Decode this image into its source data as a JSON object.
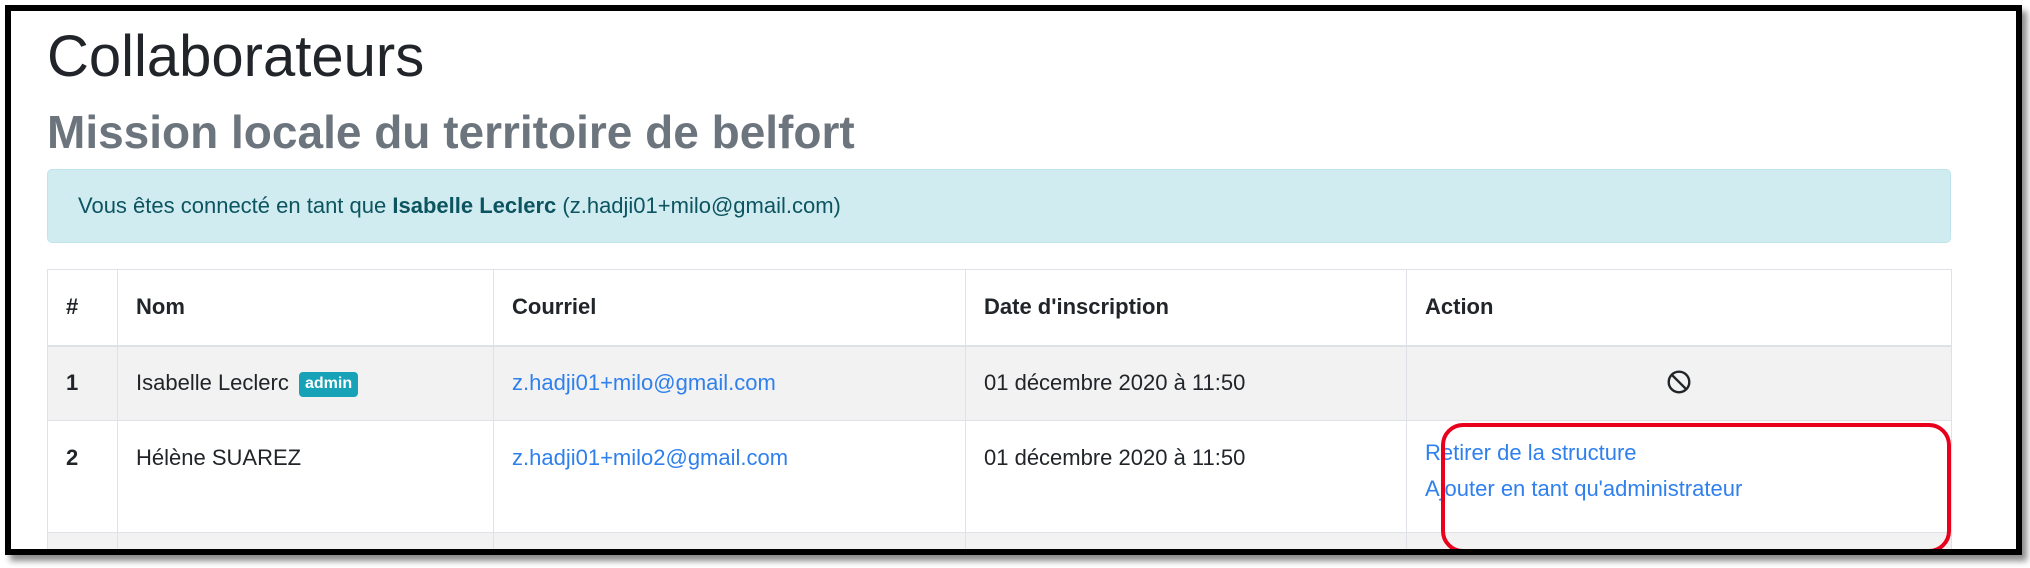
{
  "page": {
    "title": "Collaborateurs",
    "subtitle": "Mission locale du territoire de belfort"
  },
  "alert": {
    "prefix": "Vous êtes connecté en tant que",
    "user_name": "Isabelle Leclerc",
    "user_email": "(z.hadji01+milo@gmail.com)"
  },
  "table": {
    "headers": [
      "#",
      "Nom",
      "Courriel",
      "Date d'inscription",
      "Action"
    ],
    "rows": [
      {
        "num": "1",
        "name": "Isabelle Leclerc",
        "badge": "admin",
        "email": "z.hadji01+milo@gmail.com",
        "date": "01 décembre 2020 à 11:50",
        "action_icon": "ban-icon"
      },
      {
        "num": "2",
        "name": "Hélène SUAREZ",
        "email": "z.hadji01+milo2@gmail.com",
        "date": "01 décembre 2020 à 11:50",
        "actions": [
          "Retirer de la structure",
          "Ajouter en tant qu'administrateur"
        ]
      }
    ]
  },
  "colors": {
    "link": "#2f80ed",
    "alert_bg": "#d1ecf1",
    "badge_bg": "#17a2b8",
    "highlight": "#e8001c"
  }
}
